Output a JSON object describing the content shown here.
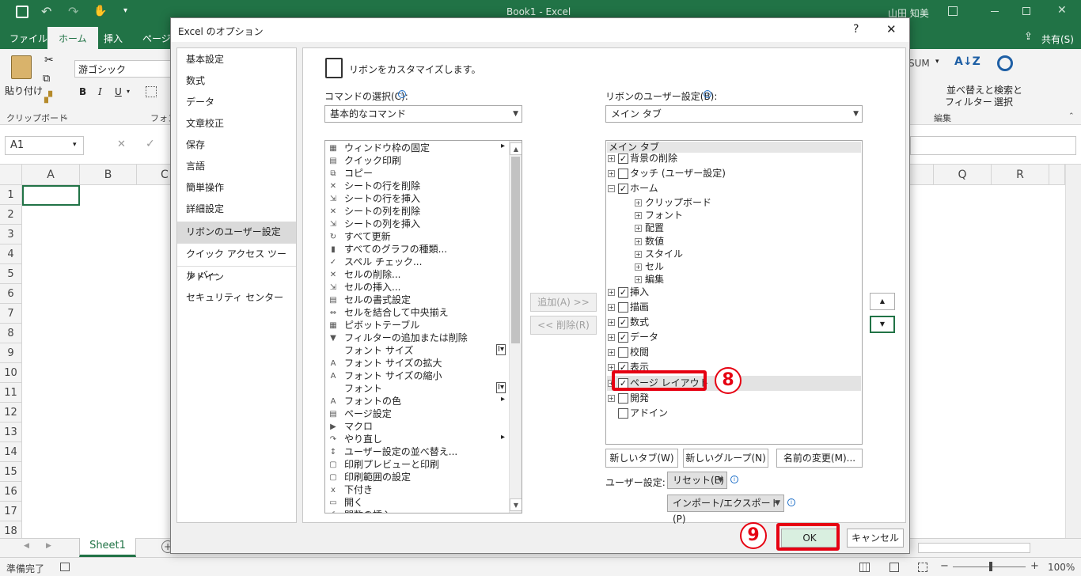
{
  "app": {
    "title": "Book1 - Excel",
    "user": "山田 知美",
    "share": "共有(S)"
  },
  "tabs": [
    "ファイル",
    "ホーム",
    "挿入",
    "ページ"
  ],
  "ribbon": {
    "paste": "貼り付け",
    "clipboard_group": "クリップボード",
    "font_name": "游ゴシック",
    "font_group": "フォン",
    "bold": "B",
    "italic": "I",
    "underline": "U",
    "sum": "SUM",
    "sort_filter_l1": "並べ替えと",
    "sort_filter_l2": "フィルター",
    "find_select_l1": "検索と",
    "find_select_l2": "選択",
    "edit_group": "編集"
  },
  "formula": {
    "name_box": "A1",
    "cancel": "✕",
    "enter": "✓"
  },
  "grid": {
    "columns_left": [
      "A",
      "B",
      "C"
    ],
    "columns_right": [
      "Q",
      "R"
    ],
    "rows": [
      "1",
      "2",
      "3",
      "4",
      "5",
      "6",
      "7",
      "8",
      "9",
      "10",
      "11",
      "12",
      "13",
      "14",
      "15",
      "16",
      "17",
      "18"
    ]
  },
  "sheet_tab": "Sheet1",
  "status": {
    "ready": "準備完了",
    "zoom": "100%"
  },
  "dialog": {
    "title": "Excel のオプション",
    "help": "?",
    "close": "✕",
    "nav": [
      "基本設定",
      "数式",
      "データ",
      "文章校正",
      "保存",
      "言語",
      "簡単操作",
      "詳細設定",
      "リボンのユーザー設定",
      "クイック アクセス ツール バー",
      "アドイン",
      "セキュリティ センター"
    ],
    "heading": "リボンをカスタマイズします。",
    "commands_label": "コマンドの選択(C):",
    "commands_value": "基本的なコマンド",
    "ribbon_label": "リボンのユーザー設定(B):",
    "ribbon_value": "メイン タブ",
    "commands": [
      "ウィンドウ枠の固定",
      "クイック印刷",
      "コピー",
      "シートの行を削除",
      "シートの行を挿入",
      "シートの列を削除",
      "シートの列を挿入",
      "すべて更新",
      "すべてのグラフの種類...",
      "スペル チェック...",
      "セルの削除...",
      "セルの挿入...",
      "セルの書式設定",
      "セルを結合して中央揃え",
      "ピボットテーブル",
      "フィルターの追加または削除",
      "フォント サイズ",
      "フォント サイズの拡大",
      "フォント サイズの縮小",
      "フォント",
      "フォントの色",
      "ページ設定",
      "マクロ",
      "やり直し",
      "ユーザー設定の並べ替え...",
      "印刷プレビューと印刷",
      "印刷範囲の設定",
      "下付き",
      "開く",
      "関数の挿入..."
    ],
    "add_button": "追加(A) >>",
    "remove_button": "<< 削除(R)",
    "tree_header": "メイン タブ",
    "tree": {
      "bg_remove": "背景の削除",
      "touch": "タッチ (ユーザー設定)",
      "home": "ホーム",
      "home_children": [
        "クリップボード",
        "フォント",
        "配置",
        "数値",
        "スタイル",
        "セル",
        "編集"
      ],
      "insert": "挿入",
      "draw": "描画",
      "formulas": "数式",
      "data": "データ",
      "review": "校閲",
      "view": "表示",
      "page_layout": "ページ レイアウト",
      "developer": "開発",
      "addins": "アドイン"
    },
    "new_tab": "新しいタブ(W)",
    "new_group": "新しいグループ(N)",
    "rename": "名前の変更(M)...",
    "custom_label": "ユーザー設定:",
    "reset": "リセット(E)",
    "import_export": "インポート/エクスポート(P)",
    "ok": "OK",
    "cancel": "キャンセル"
  },
  "badges": {
    "step8": "8",
    "step9": "9"
  },
  "colors": {
    "excel_green": "#217346",
    "highlight_red": "#e60012"
  }
}
